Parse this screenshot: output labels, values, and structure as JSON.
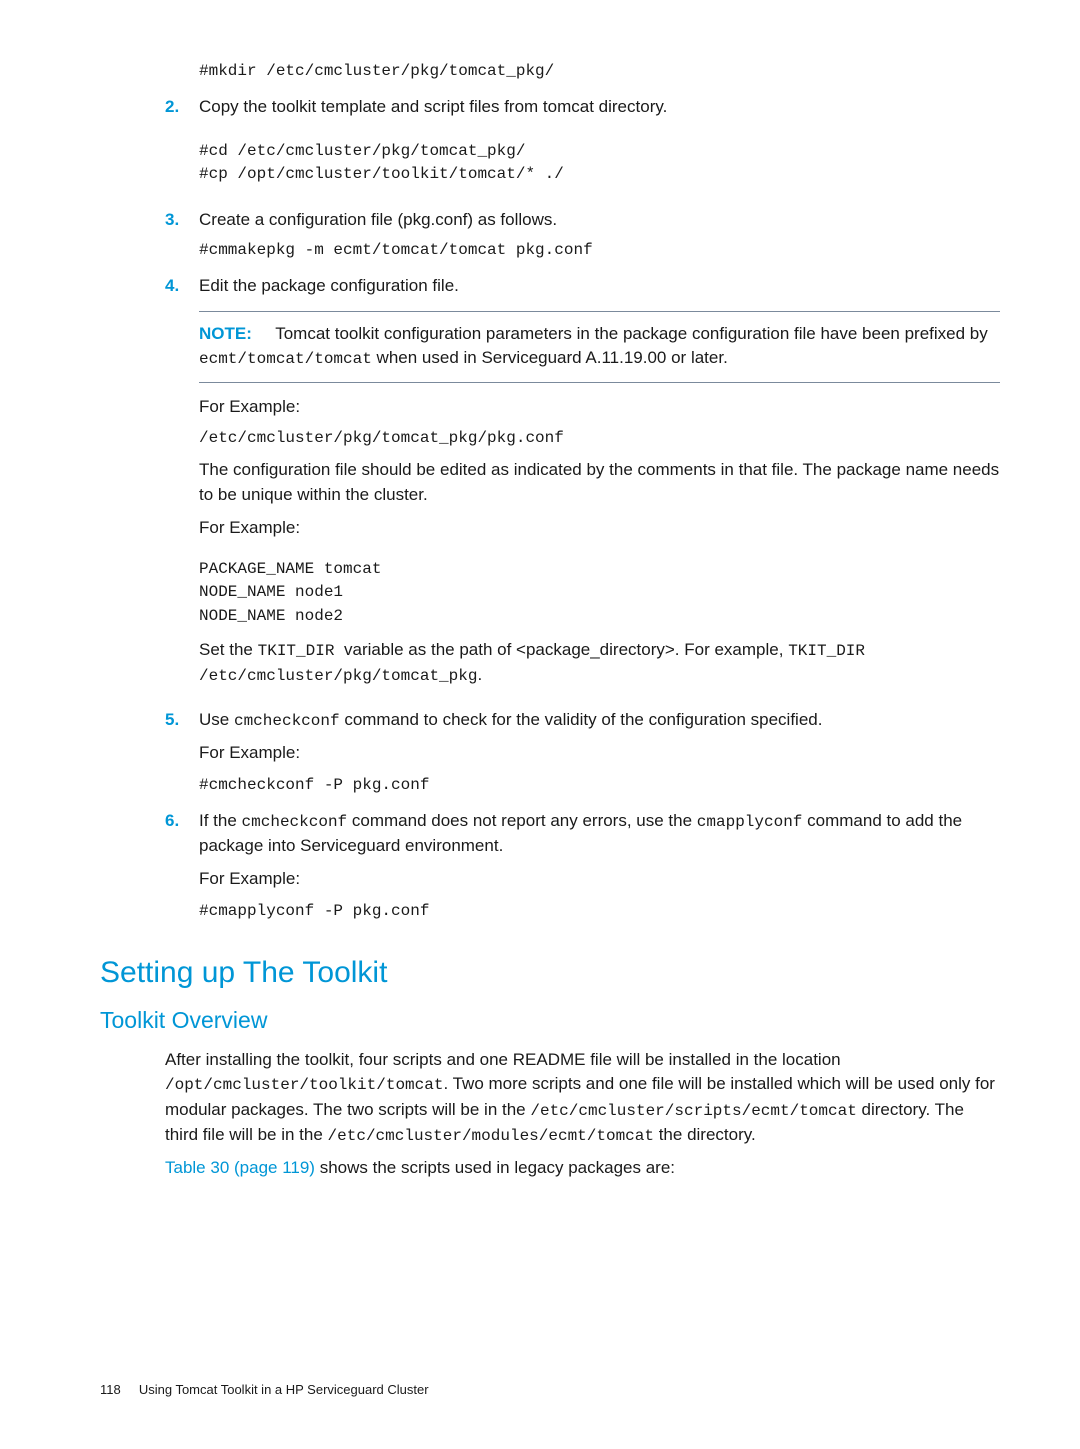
{
  "steps": {
    "s1_code": "#mkdir /etc/cmcluster/pkg/tomcat_pkg/",
    "s2_num": "2.",
    "s2_text": "Copy the toolkit template and script files from tomcat directory.",
    "s2_code": "#cd /etc/cmcluster/pkg/tomcat_pkg/\n#cp /opt/cmcluster/toolkit/tomcat/* ./",
    "s3_num": "3.",
    "s3_text": "Create a configuration file (pkg.conf) as follows.",
    "s3_code": "#cmmakepkg -m ecmt/tomcat/tomcat pkg.conf",
    "s4_num": "4.",
    "s4_text": "Edit the package configuration file.",
    "note_label": "NOTE:",
    "note_pre": "Tomcat toolkit configuration parameters in the package configuration file have been prefixed by ",
    "note_code": "ecmt/tomcat/tomcat",
    "note_post": " when used in Serviceguard A.11.19.00 or later.",
    "for_example": "For Example:",
    "s4_path": "/etc/cmcluster/pkg/tomcat_pkg/pkg.conf",
    "s4_p1": "The configuration file should be edited as indicated by the comments in that file. The package name needs to be unique within the cluster.",
    "s4_code2": "PACKAGE_NAME tomcat\nNODE_NAME node1\nNODE_NAME node2",
    "s4_set_a": "Set the ",
    "s4_set_b": "TKIT_DIR ",
    "s4_set_c": " variable as the path of <package_directory>. For example, ",
    "s4_set_d": "TKIT_DIR",
    "s4_set_e": " ",
    "s4_set_f": "/etc/cmcluster/pkg/tomcat_pkg",
    "s4_set_g": ".",
    "s5_num": "5.",
    "s5_a": "Use ",
    "s5_b": "cmcheckconf",
    "s5_c": " command to check for the validity of the configuration specified.",
    "s5_code": "#cmcheckconf -P pkg.conf",
    "s6_num": "6.",
    "s6_a": "If the ",
    "s6_b": "cmcheckconf",
    "s6_c": " command does not report any errors, use the ",
    "s6_d": "cmapplyconf",
    "s6_e": " command to add the package into Serviceguard environment.",
    "s6_code": "#cmapplyconf -P pkg.conf"
  },
  "headings": {
    "setting_up": "Setting up The Toolkit",
    "overview": "Toolkit Overview"
  },
  "overview": {
    "p1_a": "After installing the toolkit, four scripts and one README file will be installed in the location ",
    "p1_b": "/opt/cmcluster/toolkit/tomcat",
    "p1_c": ". Two more scripts and one file will be installed which will be used only for modular packages. The two scripts will be in the ",
    "p1_d": "/etc/cmcluster/scripts/ecmt/tomcat",
    "p1_e": " directory. The third file will be in the ",
    "p1_f": "/etc/cmcluster/modules/ecmt/tomcat",
    "p1_g": " the directory.",
    "p2_link": "Table 30 (page 119)",
    "p2_rest": " shows the scripts used in legacy packages are:"
  },
  "footer": {
    "page": "118",
    "title": "Using Tomcat Toolkit in a HP Serviceguard Cluster"
  }
}
